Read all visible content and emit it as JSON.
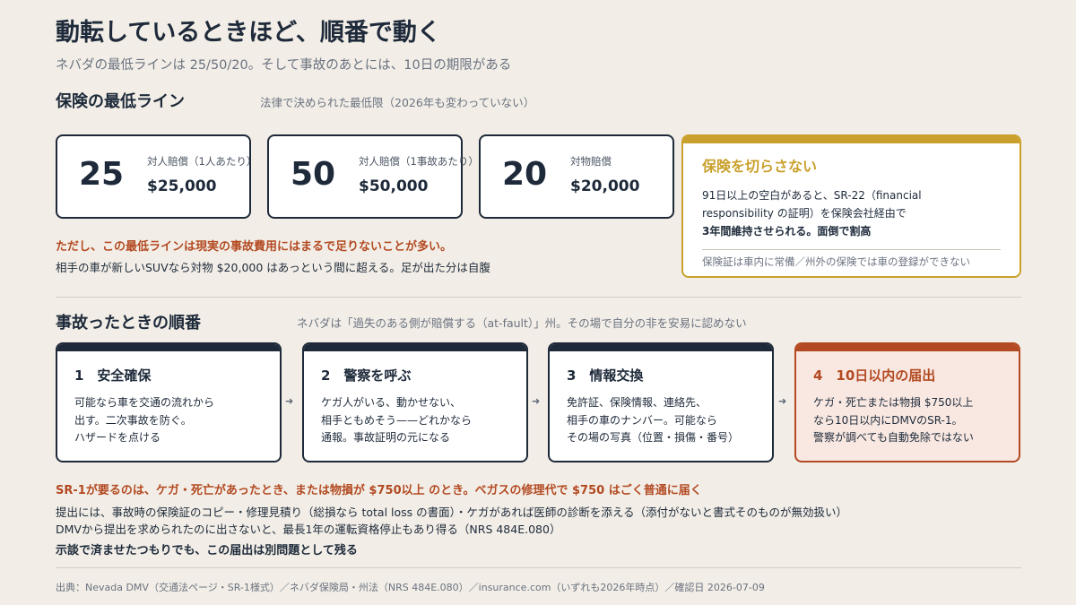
{
  "header": {
    "title": "動転しているときほど、順番で動く",
    "subtitle": "ネバダの最低ラインは 25/50/20。そして事故のあとには、10日の期限がある"
  },
  "minimums": {
    "heading": "保険の最低ライン",
    "note": "法律で決められた最低限（2026年も変わっていない）",
    "cards": [
      {
        "big": "25",
        "label": "対人賠償（1人あたり）",
        "amount": "$25,000"
      },
      {
        "big": "50",
        "label": "対人賠償（1事故あたり）",
        "amount": "$50,000"
      },
      {
        "big": "20",
        "label": "対物賠償",
        "amount": "$20,000"
      }
    ],
    "warning": "ただし、この最低ラインは現実の事故費用にはまるで足りないことが多い。",
    "warning_sub": "相手の車が新しいSUVなら対物 $20,000 はあっという間に超える。足が出た分は自腹"
  },
  "lapse": {
    "title": "保険を切らさない",
    "body_1": "91日以上の空白があると、SR-22（financial",
    "body_2": "responsibility の証明）を保険会社経由で",
    "body_3": "3年間維持させられる。面倒で割高",
    "footer": "保険証は車内に常備／州外の保険では車の登録ができない"
  },
  "procedure": {
    "heading": "事故ったときの順番",
    "note": "ネバダは「過失のある側が賠償する（at-fault）」州。その場で自分の非を安易に認めない",
    "steps": [
      {
        "title": "1　安全確保",
        "lines": [
          "可能なら車を交通の流れから",
          "出す。二次事故を防ぐ。",
          "ハザードを点ける"
        ]
      },
      {
        "title": "2　警察を呼ぶ",
        "lines": [
          "ケガ人がいる、動かせない、",
          "相手ともめそう——どれかなら",
          "通報。事故証明の元になる"
        ]
      },
      {
        "title": "3　情報交換",
        "lines": [
          "免許証、保険情報、連絡先、",
          "相手の車のナンバー。可能なら",
          "その場の写真（位置・損傷・番号）"
        ]
      },
      {
        "title": "4　10日以内の届出",
        "lines": [
          "ケガ・死亡または物損 $750以上",
          "なら10日以内にDMVのSR-1。",
          "警察が調べても自動免除ではない"
        ]
      }
    ],
    "arrow_glyph": "➜"
  },
  "sr1": {
    "headline": "SR-1が要るのは、ケガ・死亡があったとき、または物損が $750以上 のとき。ベガスの修理代で $750 はごく普通に届く",
    "line_1": "提出には、事故時の保険証のコピー・修理見積り（総損なら total loss の書面）・ケガがあれば医師の診断を添える（添付がないと書式そのものが無効扱い）",
    "line_2": "DMVから提出を求められたのに出さないと、最長1年の運転資格停止もあり得る（NRS 484E.080）",
    "bold_line": "示談で済ませたつもりでも、この届出は別問題として残る"
  },
  "source": "出典：Nevada DMV（交通法ページ・SR-1様式）／ネバダ保険局・州法（NRS 484E.080）／insurance.com（いずれも2026年時点）／確認日 2026-07-09",
  "colors": {
    "background": "#f2eee7",
    "navy": "#1e2a3a",
    "accent_orange": "#b34a22",
    "accent_gold": "#c9a02b",
    "muted": "#6b7280"
  }
}
